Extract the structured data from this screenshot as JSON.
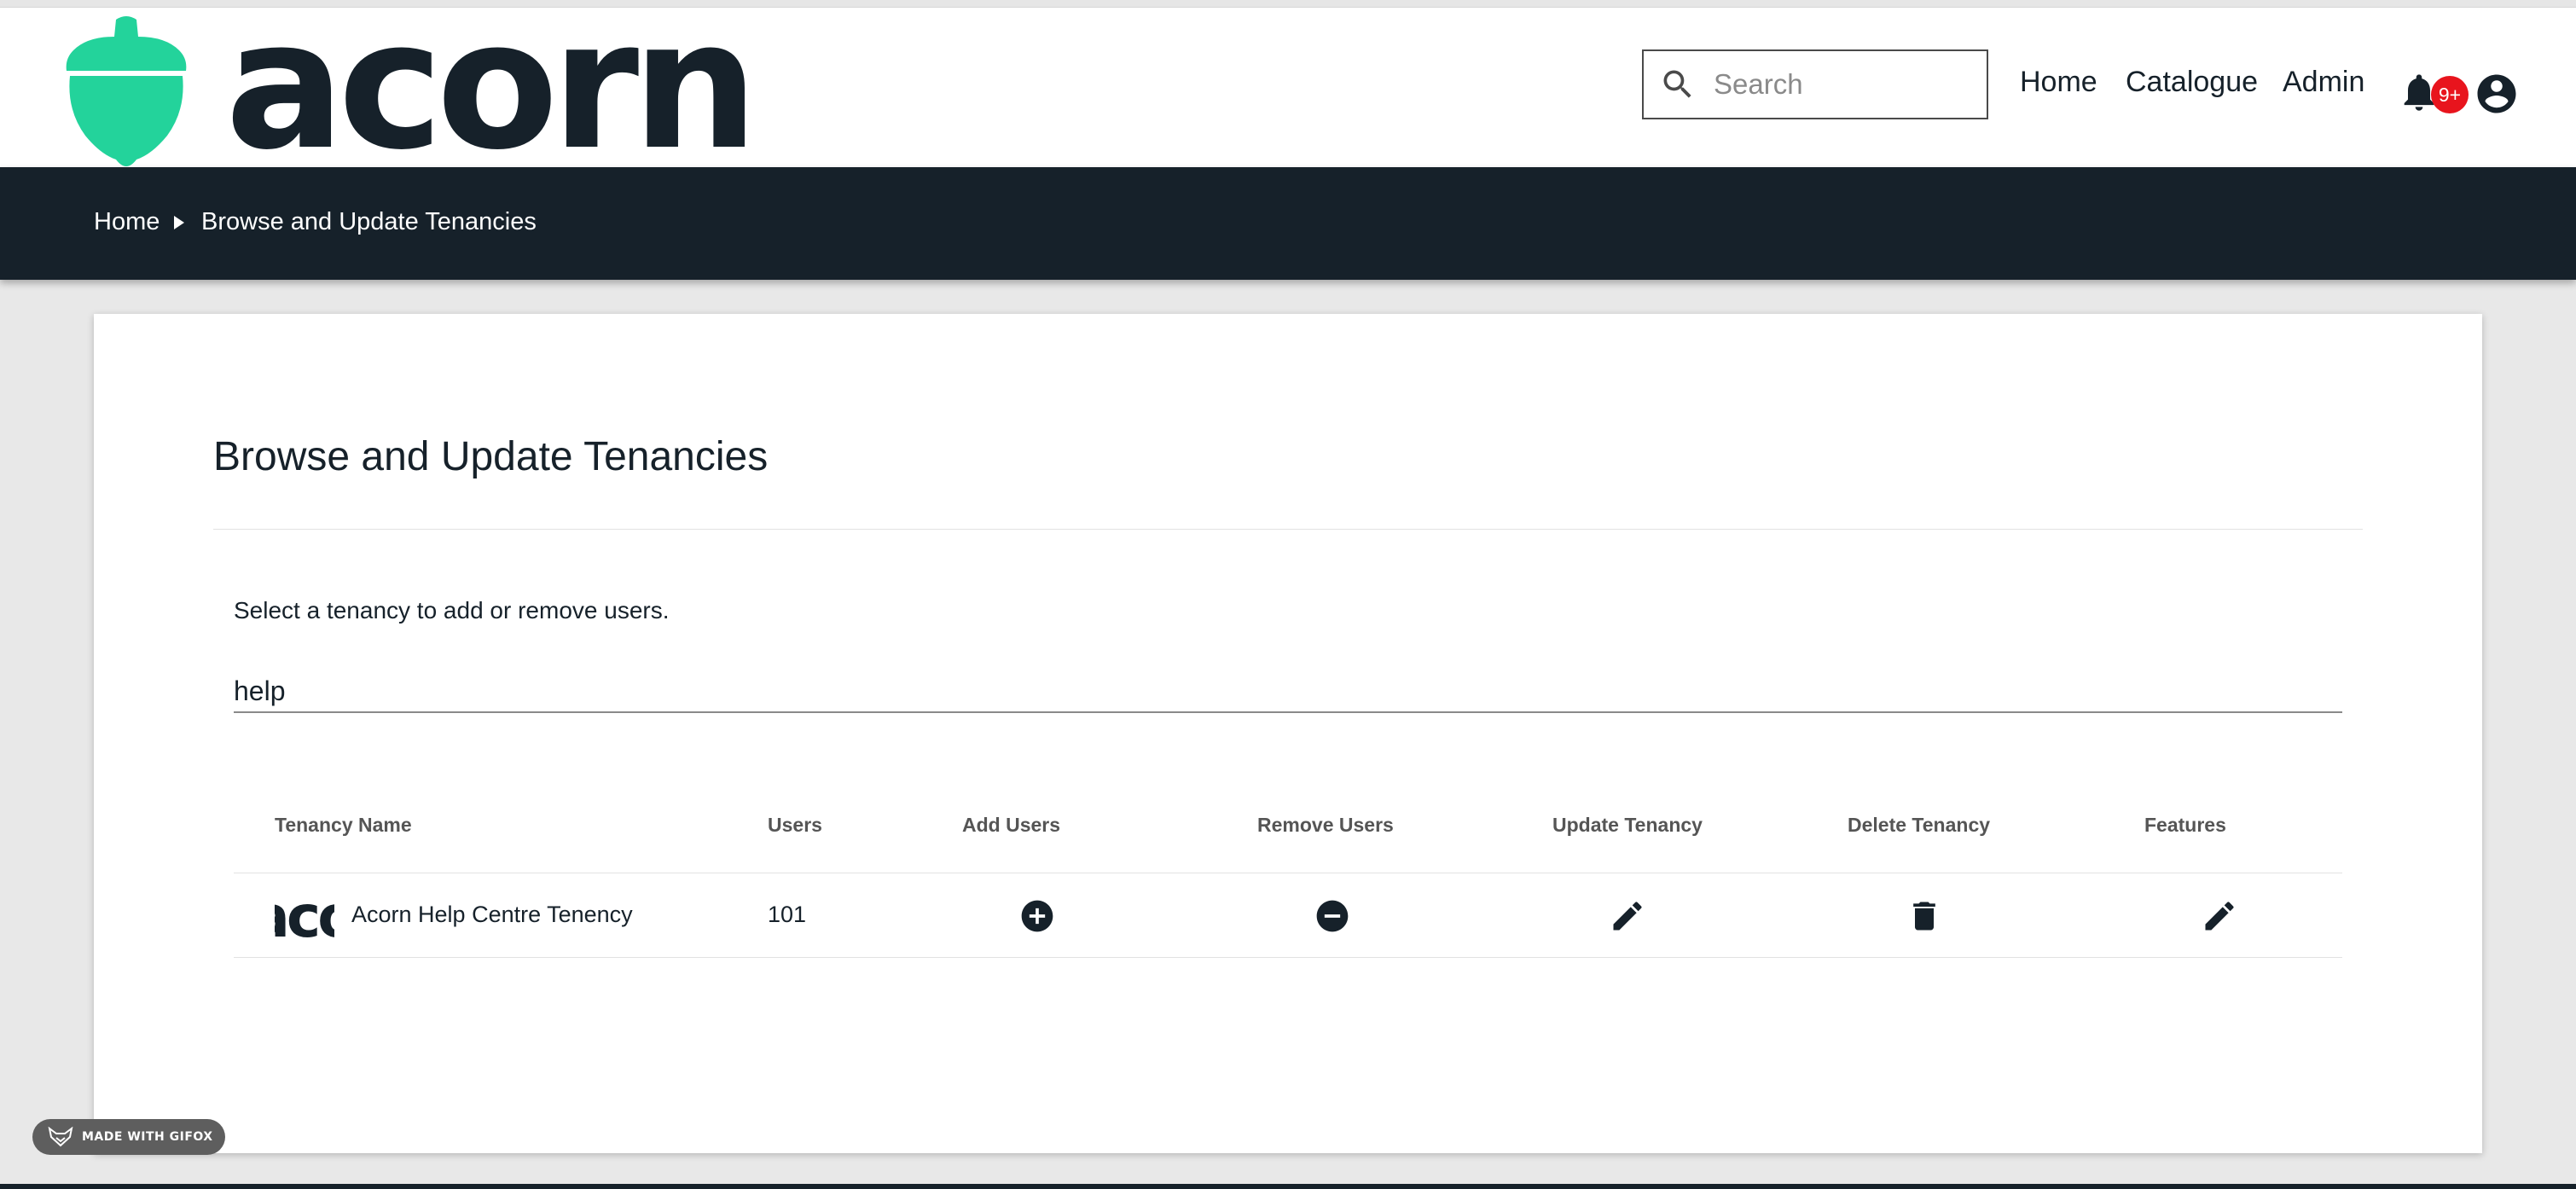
{
  "brand": {
    "name": "acorn",
    "logo_color": "#23d39b",
    "text_color": "#16212a"
  },
  "header": {
    "search": {
      "placeholder": "Search",
      "value": ""
    },
    "nav": [
      {
        "label": "Home"
      },
      {
        "label": "Catalogue"
      },
      {
        "label": "Admin"
      }
    ],
    "notifications": {
      "badge": "9+",
      "badge_color": "#e8141d"
    }
  },
  "breadcrumb": {
    "home": "Home",
    "current": "Browse and Update Tenancies"
  },
  "main": {
    "title": "Browse and Update Tenancies",
    "instructions": "Select a tenancy to add or remove users.",
    "filter": {
      "value": "help"
    },
    "table": {
      "columns": [
        "Tenancy Name",
        "Users",
        "Add Users",
        "Remove Users",
        "Update Tenancy",
        "Delete Tenancy",
        "Features"
      ],
      "rows": [
        {
          "logo_text": "acorn",
          "name": "Acorn Help Centre Tenency",
          "users": "101",
          "actions": [
            "add-circle-icon",
            "remove-circle-icon",
            "pencil-icon",
            "trash-icon",
            "pencil-icon"
          ]
        }
      ]
    }
  },
  "watermark": {
    "label": "MADE WITH GIFOX"
  }
}
